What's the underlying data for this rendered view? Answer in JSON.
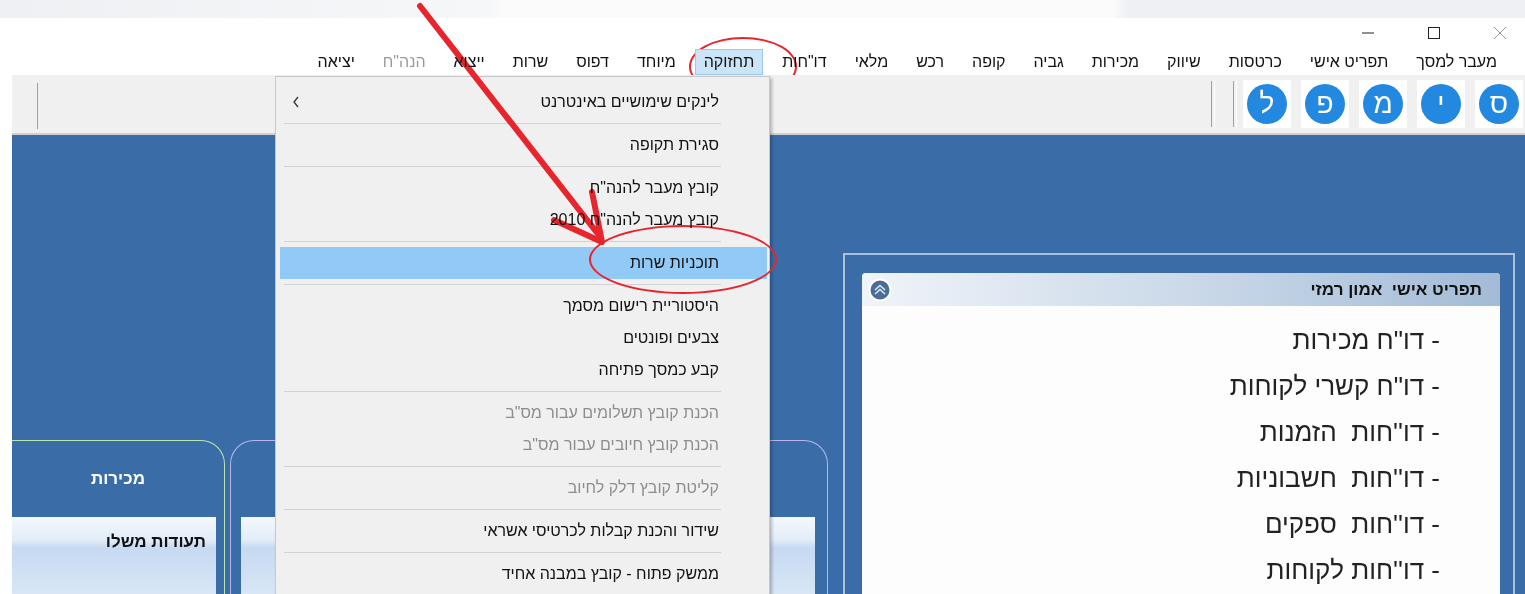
{
  "window": {
    "controls": [
      {
        "kind": "minimize"
      },
      {
        "kind": "maximize"
      },
      {
        "kind": "close"
      }
    ]
  },
  "menubar": [
    {
      "label": "מעבר למסך",
      "selected": false,
      "disabled": false,
      "circled": false
    },
    {
      "label": "תפריט אישי",
      "selected": false,
      "disabled": false,
      "circled": false
    },
    {
      "label": "כרטסות",
      "selected": false,
      "disabled": false,
      "circled": false
    },
    {
      "label": "שיווק",
      "selected": false,
      "disabled": false,
      "circled": false
    },
    {
      "label": "מכירות",
      "selected": false,
      "disabled": false,
      "circled": false
    },
    {
      "label": "גביה",
      "selected": false,
      "disabled": false,
      "circled": false
    },
    {
      "label": "קופה",
      "selected": false,
      "disabled": false,
      "circled": false
    },
    {
      "label": "רכש",
      "selected": false,
      "disabled": false,
      "circled": false
    },
    {
      "label": "מלאי",
      "selected": false,
      "disabled": false,
      "circled": false
    },
    {
      "label": "דו\"חות",
      "selected": false,
      "disabled": false,
      "circled": false
    },
    {
      "label": "תחזוקה",
      "selected": true,
      "disabled": false,
      "circled": true
    },
    {
      "label": "מיוחד",
      "selected": false,
      "disabled": false,
      "circled": false
    },
    {
      "label": "דפוס",
      "selected": false,
      "disabled": false,
      "circled": false
    },
    {
      "label": "שרות",
      "selected": false,
      "disabled": false,
      "circled": false
    },
    {
      "label": "ייצוא",
      "selected": false,
      "disabled": false,
      "circled": false
    },
    {
      "label": "הנה\"ח",
      "selected": false,
      "disabled": true,
      "circled": false
    },
    {
      "label": "יציאה",
      "selected": false,
      "disabled": false,
      "circled": false
    }
  ],
  "toolbar": {
    "buttons": [
      {
        "label": "ס"
      },
      {
        "label": "י"
      },
      {
        "label": "מ"
      },
      {
        "label": "פ"
      },
      {
        "label": "ל"
      }
    ]
  },
  "dropdown": [
    [
      {
        "label": "לינקים שימושיים באינטרנט",
        "submenu": true,
        "disabled": false,
        "selected": false,
        "circled": false
      }
    ],
    [
      {
        "label": "סגירת תקופה",
        "submenu": false,
        "disabled": false,
        "selected": false,
        "circled": false
      }
    ],
    [
      {
        "label": "קובץ מעבר להנה\"ח",
        "submenu": false,
        "disabled": false,
        "selected": false,
        "circled": false
      },
      {
        "label": "קובץ מעבר להנה\"ח 2010",
        "submenu": false,
        "disabled": false,
        "selected": false,
        "circled": false
      }
    ],
    [
      {
        "label": "תוכניות שרות",
        "submenu": false,
        "disabled": false,
        "selected": true,
        "circled": true
      }
    ],
    [
      {
        "label": "היסטוריית רישום מסמך",
        "submenu": false,
        "disabled": false,
        "selected": false,
        "circled": false
      },
      {
        "label": "צבעים ופונטים",
        "submenu": false,
        "disabled": false,
        "selected": false,
        "circled": false
      },
      {
        "label": "קבע כמסך פתיחה",
        "submenu": false,
        "disabled": false,
        "selected": false,
        "circled": false
      }
    ],
    [
      {
        "label": "הכנת קובץ תשלומים עבור מס\"ב",
        "submenu": false,
        "disabled": true,
        "selected": false,
        "circled": false
      },
      {
        "label": "הכנת קובץ חיובים עבור מס\"ב",
        "submenu": false,
        "disabled": true,
        "selected": false,
        "circled": false
      }
    ],
    [
      {
        "label": "קליטת קובץ דלק לחיוב",
        "submenu": false,
        "disabled": true,
        "selected": false,
        "circled": false
      }
    ],
    [
      {
        "label": "שידור והכנת קבלות לכרטיסי אשראי",
        "submenu": false,
        "disabled": false,
        "selected": false,
        "circled": false
      }
    ],
    [
      {
        "label": "ממשק פתוח - קובץ במבנה אחיד",
        "submenu": false,
        "disabled": false,
        "selected": false,
        "circled": false
      }
    ]
  ],
  "tabs": [
    {
      "kind": "titled",
      "title": "מכירות",
      "section": "תעודות משלו"
    },
    {
      "kind": "covered"
    }
  ],
  "personal_menu": {
    "title": "תפריט אישי  אמון רמזי",
    "items": [
      "- דו\"ח מכירות",
      "- דו\"ח קשרי לקוחות",
      "- דו''חות  הזמנות",
      "- דו''חות  חשבוניות",
      "- דו''חות  ספקים",
      "- דו''חות לקוחות"
    ]
  },
  "annotations": [
    {
      "kind": "arrow"
    }
  ]
}
